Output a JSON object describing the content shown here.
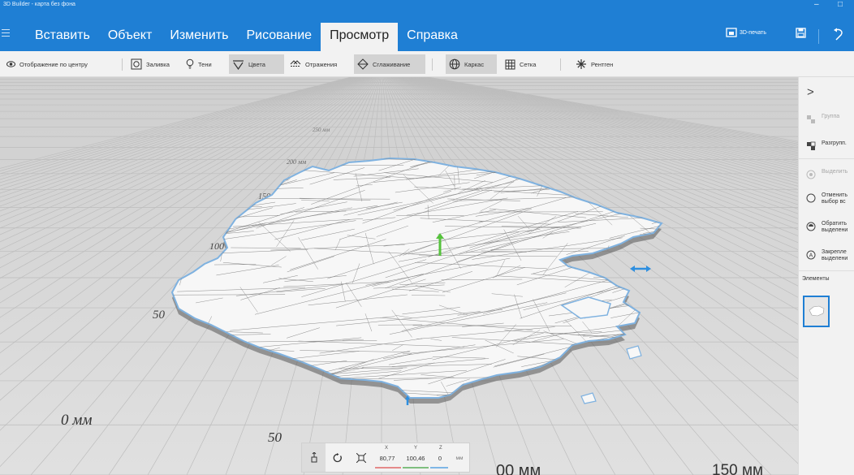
{
  "window": {
    "title": "3D Builder - карта без фона",
    "minimize": "–",
    "maximize": "□"
  },
  "ribbon": {
    "tabs": [
      {
        "label": "Вставить"
      },
      {
        "label": "Объект"
      },
      {
        "label": "Изменить"
      },
      {
        "label": "Рисование"
      },
      {
        "label": "Просмотр",
        "active": true
      },
      {
        "label": "Справка"
      }
    ],
    "print3d_label": "3D-печать"
  },
  "toolbar": {
    "center_view": "Отображение по центру",
    "fill": "Заливка",
    "shadows": "Тени",
    "colors": "Цвета",
    "reflections": "Отражения",
    "smoothing": "Сглаживание",
    "wireframe": "Каркас",
    "grid": "Сетка",
    "xray": "Рентген"
  },
  "panel": {
    "group": "Группа",
    "ungroup": "Разгрупп.",
    "select_all": "Выделить",
    "deselect_all": [
      "Отменить",
      "выбор вс"
    ],
    "invert_selection": [
      "Обратить",
      "выделени"
    ],
    "pin_selection": [
      "Закрепле",
      "выделени"
    ],
    "elements_label": "Элементы"
  },
  "grid_labels": {
    "l0": "0 мм",
    "l50": "50",
    "l50b": "50",
    "l100": "100 мм",
    "l150": "150",
    "l200": "200 мм",
    "l250": "250 мм",
    "b100": "00 мм",
    "b150": "150 мм"
  },
  "transform": {
    "x_label": "X",
    "y_label": "Y",
    "z_label": "Z",
    "x": "80,77",
    "y": "100,46",
    "z": "0",
    "unit": "мм"
  },
  "colors": {
    "accent": "#1f7fd4",
    "toolbar_bg": "#f2f2f2",
    "grid_bg": "#d9d9d9",
    "model_fill": "#f7f7f7"
  }
}
